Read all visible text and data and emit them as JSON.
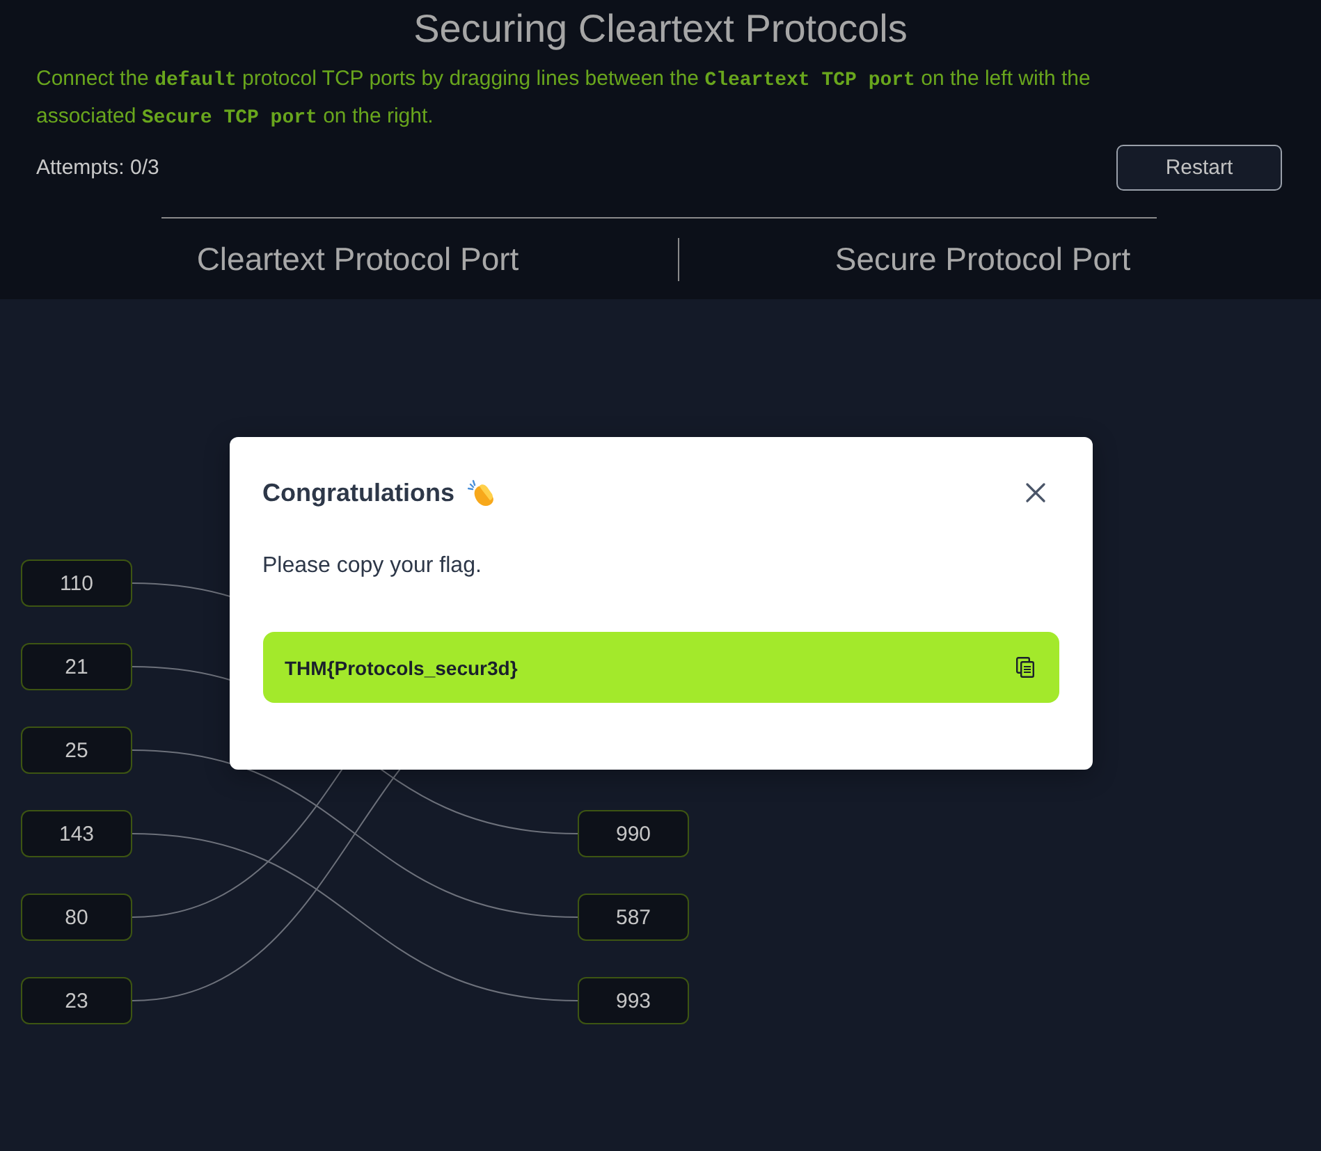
{
  "header": {
    "title": "Securing Cleartext Protocols",
    "instructions": "Connect the **default** protocol TCP ports by dragging lines between the **Cleartext TCP port** on the left with the associated **Secure TCP port** on the right.",
    "attempts": "Attempts: 0/3",
    "restart_button": "Restart"
  },
  "columns": [
    "Cleartext Protocol Port",
    "Secure Protocol Port"
  ],
  "board": {
    "left_ports": [
      "110",
      "21",
      "25",
      "143",
      "80",
      "23"
    ],
    "right_ports": [
      "990",
      "587",
      "993"
    ]
  },
  "dialog": {
    "title": "Congratulations",
    "message": "Please copy your flag.",
    "flag": "THM{Protocols_secur3d}"
  }
}
